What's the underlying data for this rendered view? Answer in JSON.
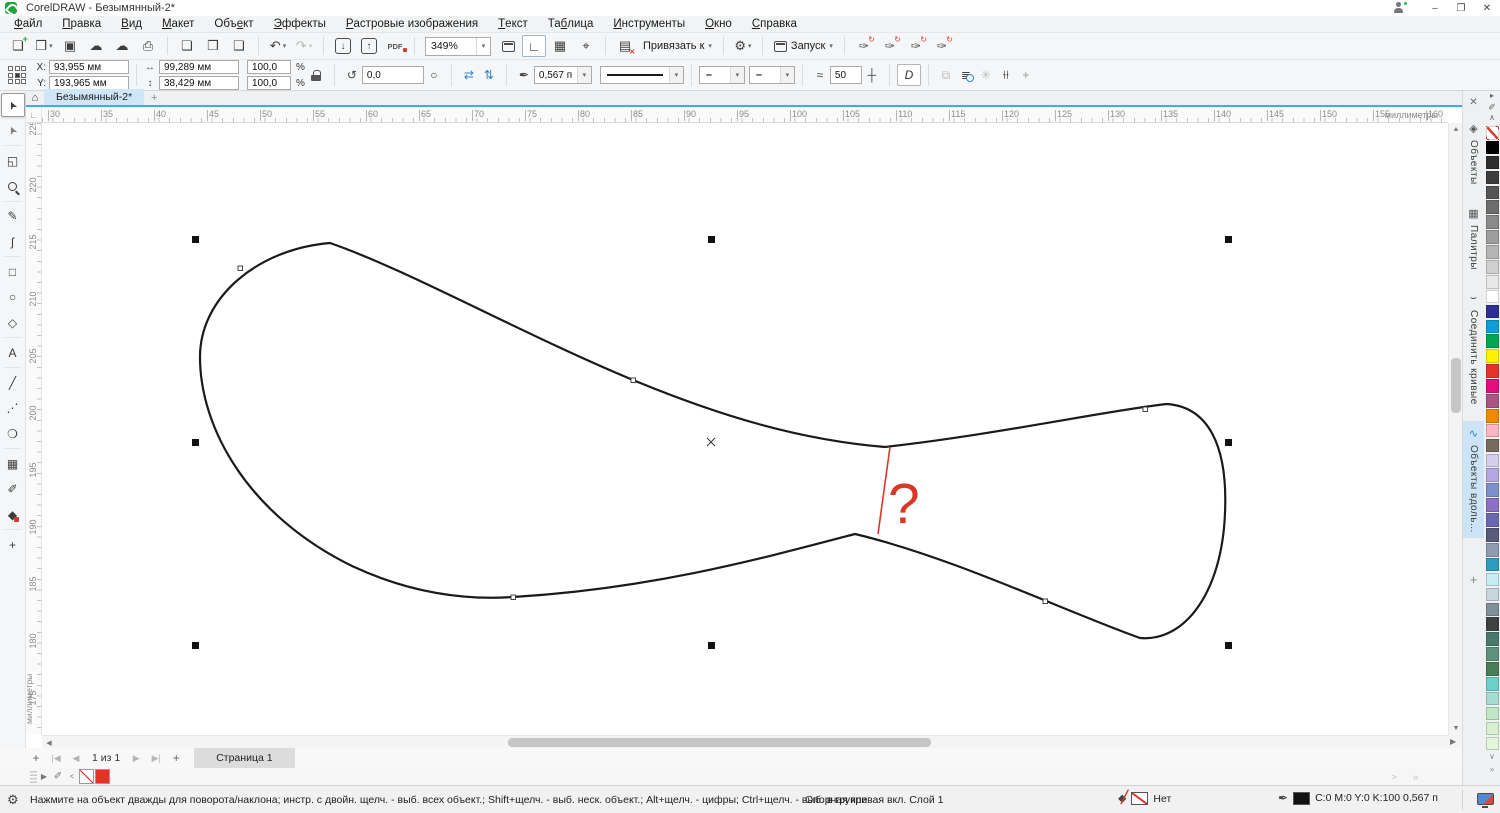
{
  "window": {
    "title": "CorelDRAW - Безымянный-2*",
    "minimize": "–",
    "restore": "❐",
    "close": "✕"
  },
  "menu": {
    "items": [
      {
        "id": "file",
        "label": "Файл",
        "u": 0
      },
      {
        "id": "edit",
        "label": "Правка",
        "u": 0
      },
      {
        "id": "view",
        "label": "Вид",
        "u": 0
      },
      {
        "id": "layout",
        "label": "Макет",
        "u": 0
      },
      {
        "id": "object",
        "label": "Объект",
        "u": 3
      },
      {
        "id": "effects",
        "label": "Эффекты",
        "u": 0
      },
      {
        "id": "bitmaps",
        "label": "Растровые изображения",
        "u": 0
      },
      {
        "id": "text",
        "label": "Текст",
        "u": 0
      },
      {
        "id": "table",
        "label": "Таблица",
        "u": 2
      },
      {
        "id": "tools",
        "label": "Инструменты",
        "u": 0
      },
      {
        "id": "window",
        "label": "Окно",
        "u": 0
      },
      {
        "id": "help",
        "label": "Справка",
        "u": 0
      }
    ]
  },
  "toolbar": {
    "zoom_value": "349%",
    "snap_label": "Привязать к",
    "launch_label": "Запуск",
    "pdf_label": "PDF"
  },
  "property_bar": {
    "x_label": "X:",
    "x_value": "93,955 мм",
    "y_label": "Y:",
    "y_value": "193,965 мм",
    "width_value": "99,289 мм",
    "height_value": "38,429 мм",
    "scale_x": "100,0",
    "scale_y": "100,0",
    "percent_x": "%",
    "percent_y": "%",
    "angle_value": "0,0",
    "outline_width": "0,567 п",
    "smooth_value": "50",
    "close_curve_label": "D"
  },
  "doc_tabs": {
    "active": "Безымянный-2*",
    "add_label": "+"
  },
  "rulers": {
    "horizontal": [
      30,
      35,
      40,
      45,
      50,
      55,
      60,
      65,
      70,
      75,
      80,
      85,
      90,
      95,
      100,
      105,
      110,
      115,
      120,
      125,
      130,
      135,
      140,
      145,
      150,
      155,
      160
    ],
    "vertical": [
      225,
      220,
      215,
      210,
      205,
      200,
      195,
      190,
      185,
      180,
      175
    ],
    "units_label": "миллиметры"
  },
  "toolbox": {
    "tools": [
      {
        "id": "pick",
        "glyph": "➤",
        "cls": "g-pick",
        "active": true
      },
      {
        "id": "shape",
        "glyph": "➤",
        "cls": "g-shape"
      },
      {
        "id": "crop",
        "glyph": "◱"
      },
      {
        "id": "zoom",
        "glyph": "",
        "cls": "mag-holder"
      },
      {
        "id": "freehand",
        "glyph": "✎"
      },
      {
        "id": "artistic-media",
        "glyph": "ʃ"
      },
      {
        "id": "rectangle",
        "glyph": "□"
      },
      {
        "id": "ellipse",
        "glyph": "○"
      },
      {
        "id": "polygon",
        "glyph": "◇"
      },
      {
        "id": "text",
        "glyph": "А"
      },
      {
        "id": "line",
        "glyph": "╱"
      },
      {
        "id": "connector",
        "glyph": "⋰"
      },
      {
        "id": "drop-shadow",
        "glyph": "❍"
      },
      {
        "id": "transparency",
        "glyph": "▦"
      },
      {
        "id": "eyedropper",
        "glyph": "✐"
      },
      {
        "id": "fill",
        "glyph": "◆",
        "cls": "g-fill"
      },
      {
        "id": "more-tools",
        "glyph": "+"
      }
    ]
  },
  "dockers": {
    "close_label": "✕",
    "add_label": "+",
    "tabs": [
      {
        "id": "objects",
        "label": "Объекты",
        "glyph": "◈"
      },
      {
        "id": "palettes",
        "label": "Палитры",
        "glyph": "▦"
      },
      {
        "id": "join-curves",
        "label": "Соединить кривые",
        "glyph": "⌣"
      },
      {
        "id": "objects-along",
        "label": "Объекты вдоль...",
        "glyph": "∿",
        "active": true
      }
    ]
  },
  "palette": {
    "colors": [
      "none",
      "#000000",
      "#2e2e2e",
      "#3d3d3d",
      "#555555",
      "#6e6e6e",
      "#8a8a8a",
      "#9e9e9e",
      "#b5b5b5",
      "#cfcfcf",
      "#e8e8e8",
      "#ffffff",
      "#2e3192",
      "#0e9ed9",
      "#00a651",
      "#fff200",
      "#e2342a",
      "#e50d7e",
      "#ab5382",
      "#f18a00",
      "#ffb5c0",
      "#796a60",
      "#d5cdec",
      "#b3a7e3",
      "#7c90cc",
      "#8d6fc3",
      "#6a6ab2",
      "#5a5a7d",
      "#8f9cb0",
      "#2d9cbe",
      "#c6eef2",
      "#c7d6dc",
      "#7e919b",
      "#3e4342",
      "#49796a",
      "#60917f",
      "#4a7c57",
      "#69d1c8",
      "#a6dcd0",
      "#c2e7c6",
      "#d6f0d1",
      "#e3f5dc"
    ]
  },
  "pages": {
    "nav_text": "1 из 1",
    "page_tab": "Страница 1"
  },
  "doc_palette": {
    "colors": [
      "none",
      "#e13524"
    ]
  },
  "status": {
    "hint": "Нажмите на объект дважды для поворота/наклона; инстр. с двойн. щелч. - выб. всех объект.; Shift+щелч. - выб. неск. объект.; Alt+щелч. - цифры; Ctrl+щелч. - выб. в группе",
    "layer_info": "Опорная кривая вкл. Слой 1",
    "fill_label": "Нет",
    "outline_info": "C:0 M:0 Y:0 K:100  0,567 п"
  },
  "canvas": {
    "annotation": "?",
    "annotation_color": "#d93827",
    "curve_color": "#1a1a1a"
  }
}
